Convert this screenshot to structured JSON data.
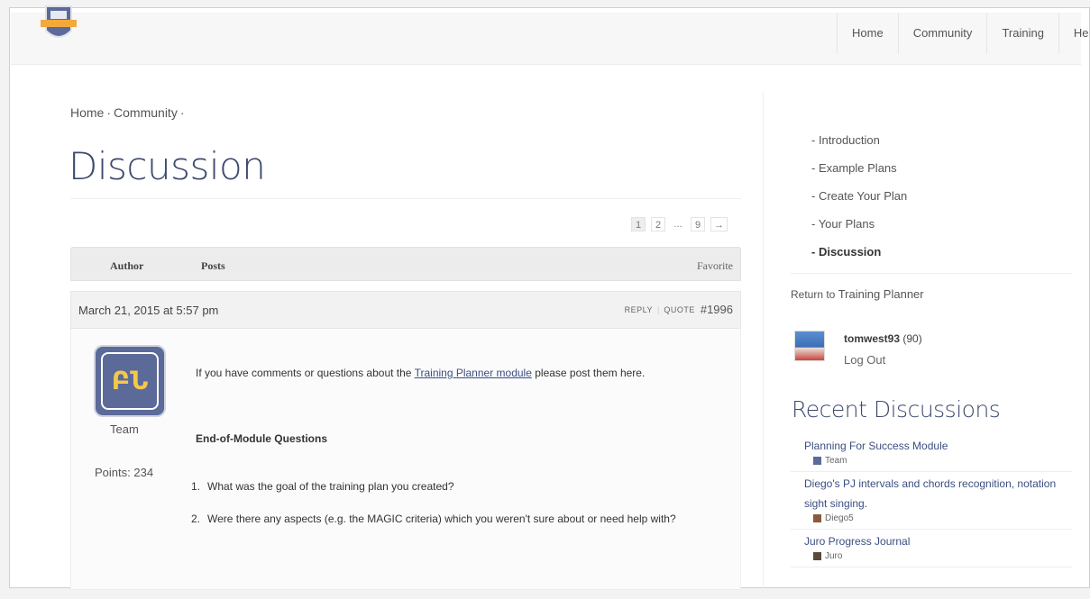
{
  "header": {
    "nav": [
      "Home",
      "Community",
      "Training",
      "He"
    ]
  },
  "breadcrumb": [
    "Home",
    "·",
    "Community",
    "·"
  ],
  "page": {
    "title": "Discussion"
  },
  "pagination": [
    "1",
    "2",
    "...",
    "9",
    "→"
  ],
  "table": {
    "author_label": "Author",
    "posts_label": "Posts",
    "favorite_label": "Favorite"
  },
  "post": {
    "date": "March 21, 2015 at 5:57 pm",
    "reply_label": "REPLY",
    "quote_label": "QUOTE",
    "post_id": "#1996",
    "avatar_text": "ԲՆ",
    "author_role": "Team",
    "points": "Points: 234",
    "intro_before": "If you have comments or questions about the ",
    "intro_link": "Training Planner module",
    "intro_after": " please post them here.",
    "heading": "End-of-Module Questions",
    "questions": [
      {
        "num": "1.",
        "text": "What was the goal of the training plan you created?"
      },
      {
        "num": "2.",
        "text": "Were there any aspects (e.g. the MAGIC criteria) which you weren't sure about or need help with?"
      }
    ]
  },
  "sidebar": {
    "nav": [
      {
        "label": "- Introduction",
        "active": false
      },
      {
        "label": "- Example Plans",
        "active": false
      },
      {
        "label": "- Create Your Plan",
        "active": false
      },
      {
        "label": "- Your Plans",
        "active": false
      },
      {
        "label": "- Discussion",
        "active": true
      }
    ],
    "return_prefix": "Return to ",
    "return_link": "Training Planner",
    "user": {
      "name": "tomwest93",
      "score": " (90)",
      "logout": "Log Out"
    },
    "recent_title": "Recent Discussions",
    "recent": [
      {
        "topic": "Planning For Success Module",
        "by": "Team",
        "color": "#5b6a99"
      },
      {
        "topic": "Diego's PJ intervals and chords recognition, notation sight singing.",
        "by": "Diego5",
        "color": "#8a5a3c"
      },
      {
        "topic": "Juro Progress Journal",
        "by": "Juro",
        "color": "#5a4a3a"
      }
    ]
  },
  "colors": {
    "title": "#3c4a6e",
    "link": "#3b4f82",
    "avatar_bg": "#5b6a99"
  }
}
